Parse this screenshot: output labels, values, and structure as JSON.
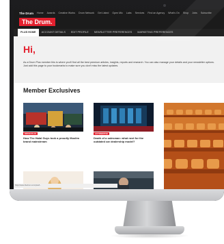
{
  "topbar": {
    "logo": "The Drum",
    "links": [
      "Home",
      "Awards",
      "Creative Works",
      "Drum Network",
      "Get Listed",
      "Open Mic",
      "Labs",
      "Services",
      "Find an Agency",
      "What's On",
      "Shop",
      "Jobs",
      "Subscribe"
    ]
  },
  "masthead": {
    "brand": "The Drum."
  },
  "nav": {
    "tabs": [
      "PLUS HOME",
      "ACCOUNT DETAILS",
      "EDIT PROFILE",
      "NEWSLETTER PREFERENCES",
      "MARKETING PREFERENCES"
    ],
    "active_index": 0
  },
  "hero": {
    "greeting": "Hi,",
    "intro": "As a Drum Plus member this is where you'll find all the best premium articles, insights, reports and research. You can also manage your details and your newsletter options. Just add this page to your bookmarks to make sure you don't miss the latest updates."
  },
  "section": {
    "title": "Member Exclusives"
  },
  "cards": [
    {
      "tag": "DRUM PLUS",
      "headline": "How The Halal Guys took a proudly Muslim brand mainstream"
    },
    {
      "tag": "AUTOMOTIVE",
      "headline": "Death of a salesman: what next for the outdated car dealership model?"
    }
  ],
  "status_bar": {
    "text": "https://www.thedrum.com/plus#..."
  },
  "colors": {
    "brand_red": "#e3202e",
    "dark": "#1b1b1b",
    "hero_bg": "#f1f1f1"
  }
}
